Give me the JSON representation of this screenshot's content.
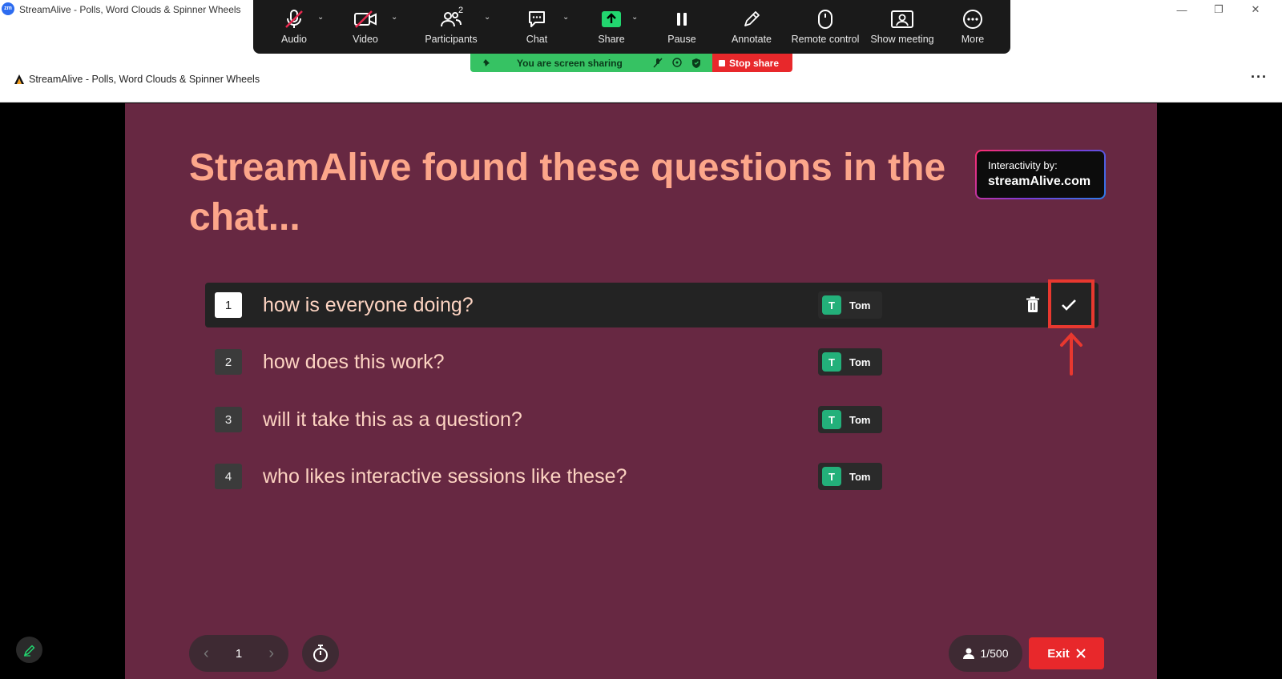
{
  "window": {
    "title": "StreamAlive - Polls, Word Clouds & Spinner Wheels",
    "app_badge": "zm"
  },
  "browser": {
    "page_title": "StreamAlive - Polls, Word Clouds & Spinner Wheels",
    "menu_icon": "more-dots-icon"
  },
  "zoom_toolbar": {
    "items": [
      {
        "label": "Audio",
        "icon": "microphone-muted-icon"
      },
      {
        "label": "Video",
        "icon": "video-off-icon"
      },
      {
        "label": "Participants",
        "icon": "participants-icon",
        "count": "2"
      },
      {
        "label": "Chat",
        "icon": "chat-icon"
      },
      {
        "label": "Share",
        "icon": "share-screen-icon"
      },
      {
        "label": "Pause",
        "icon": "pause-icon"
      },
      {
        "label": "Annotate",
        "icon": "pencil-icon"
      },
      {
        "label": "Remote control",
        "icon": "mouse-icon"
      },
      {
        "label": "Show meeting",
        "icon": "show-meeting-icon"
      },
      {
        "label": "More",
        "icon": "more-icon"
      }
    ],
    "share_status": "You are screen sharing",
    "stop_share": "Stop share",
    "accent_green": "#36c263",
    "accent_red": "#e8282b"
  },
  "slide": {
    "headline": "StreamAlive found these questions in the chat...",
    "brand_line1": "Interactivity by:",
    "brand_line2": "streamAlive.com",
    "background": "#672842",
    "questions": [
      {
        "num": "1",
        "text": "how is everyone doing?",
        "author_initial": "T",
        "author": "Tom",
        "active": true
      },
      {
        "num": "2",
        "text": "how does this work?",
        "author_initial": "T",
        "author": "Tom",
        "active": false
      },
      {
        "num": "3",
        "text": "will it take this as a question?",
        "author_initial": "T",
        "author": "Tom",
        "active": false
      },
      {
        "num": "4",
        "text": "who likes interactive sessions like these?",
        "author_initial": "T",
        "author": "Tom",
        "active": false
      }
    ],
    "controls": {
      "page": "1",
      "participants": "1/500",
      "exit_label": "Exit"
    }
  }
}
